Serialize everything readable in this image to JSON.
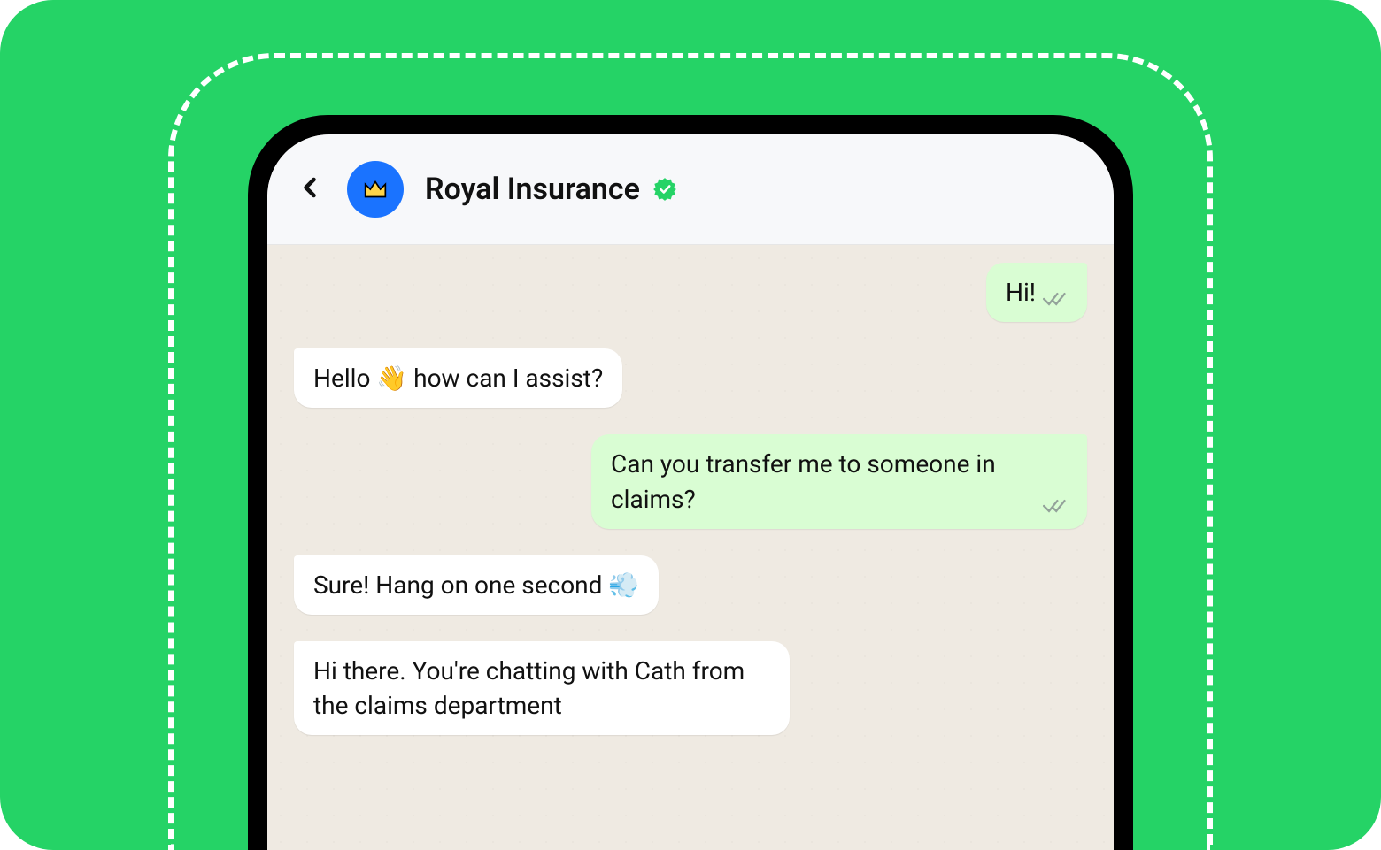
{
  "chat": {
    "title": "Royal Insurance",
    "verified": true,
    "messages": [
      {
        "side": "sent",
        "text": "Hi!"
      },
      {
        "side": "received",
        "text": "Hello 👋 how can I assist?"
      },
      {
        "side": "sent",
        "text": "Can you transfer me to someone in claims?"
      },
      {
        "side": "received",
        "text": "Sure! Hang on one second 💨"
      },
      {
        "side": "received",
        "text": "Hi there. You're chatting with Cath from the claims department"
      }
    ]
  }
}
